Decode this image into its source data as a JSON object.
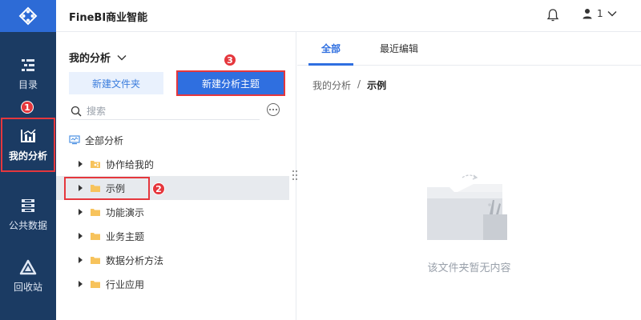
{
  "app": {
    "title": "FineBI商业智能"
  },
  "rail": {
    "items": [
      {
        "label": "目录"
      },
      {
        "label": "我的分析"
      },
      {
        "label": "公共数据"
      },
      {
        "label": "回收站"
      }
    ]
  },
  "header": {
    "user_label": "1"
  },
  "panel": {
    "title": "我的分析",
    "new_folder_label": "新建文件夹",
    "new_subject_label": "新建分析主题",
    "search_placeholder": "搜索",
    "tree": {
      "root": "全部分析",
      "items": [
        {
          "label": "协作给我的"
        },
        {
          "label": "示例"
        },
        {
          "label": "功能演示"
        },
        {
          "label": "业务主题"
        },
        {
          "label": "数据分析方法"
        },
        {
          "label": "行业应用"
        }
      ]
    }
  },
  "content": {
    "tabs": [
      {
        "label": "全部"
      },
      {
        "label": "最近编辑"
      }
    ],
    "breadcrumb": {
      "parent": "我的分析",
      "separator": "/",
      "current": "示例"
    },
    "empty_text": "该文件夹暂无内容"
  },
  "annotations": {
    "badge1": "1",
    "badge2": "2",
    "badge3": "3"
  },
  "colors": {
    "rail_bg": "#1b3b63",
    "accent": "#2f6fe0",
    "highlight_red": "#e5373d"
  },
  "icons": {
    "logo": "fine-logo-icon",
    "catalog": "catalog-icon",
    "my_analysis": "chart-icon",
    "public_data": "database-icon",
    "recycle": "recycle-icon",
    "bell": "bell-icon",
    "user": "user-icon",
    "search": "search-icon",
    "more": "more-icon",
    "folder": "folder-icon"
  }
}
